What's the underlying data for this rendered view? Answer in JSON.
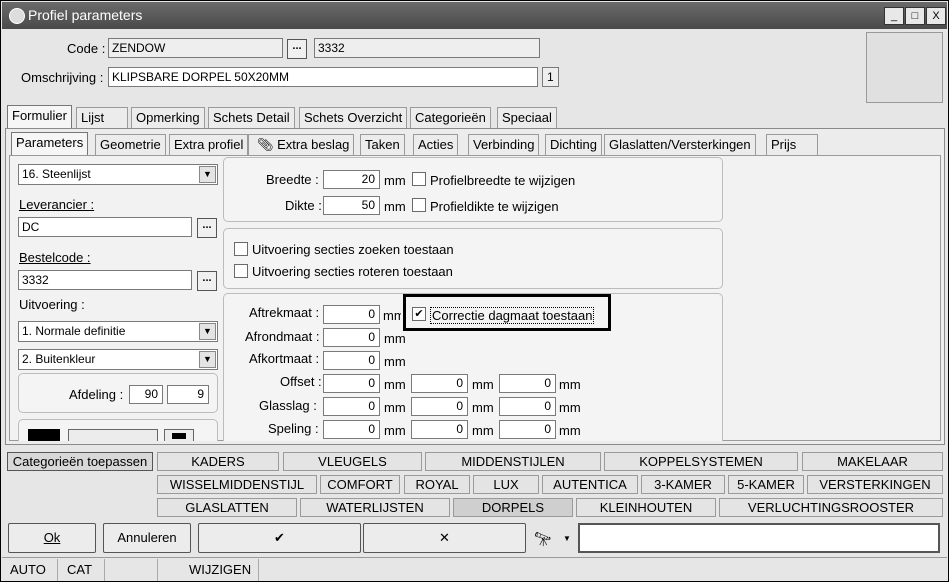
{
  "window": {
    "title": "Profiel parameters",
    "min": "_",
    "max": "□",
    "close": "X"
  },
  "header": {
    "code_label": "Code :",
    "code_value": "ZENDOW",
    "code_number": "3332",
    "desc_label": "Omschrijving :",
    "desc_value": "KLIPSBARE DORPEL 50X20MM",
    "desc_count": "1",
    "dots": "..."
  },
  "main_tabs": [
    "Formulier",
    "Lijst",
    "Opmerking",
    "Schets Detail",
    "Schets Overzicht",
    "Categorieën",
    "Speciaal"
  ],
  "sub_tabs": [
    "Parameters",
    "Geometrie",
    "Extra profiel",
    "Extra beslag",
    "Taken",
    "Acties",
    "Verbinding",
    "Dichting",
    "Glaslatten/Versterkingen",
    "Prijs"
  ],
  "left": {
    "list_select": "16. Steenlijst",
    "leverancier_label": "Leverancier :",
    "leverancier_value": "DC",
    "bestelcode_label": "Bestelcode :",
    "bestelcode_value": "3332",
    "uitvoering_label": "Uitvoering :",
    "uitvoering1": "1.  Normale definitie",
    "uitvoering2": "2.  Buitenkleur",
    "afdeling_label": "Afdeling :",
    "afdeling1": "90",
    "afdeling2": "9"
  },
  "dims": {
    "breedte_label": "Breedte :",
    "breedte": "20",
    "dikte_label": "Dikte :",
    "dikte": "50",
    "unit": "mm",
    "chk_breedte": "Profielbreedte te wijzigen",
    "chk_dikte": "Profieldikte te wijzigen"
  },
  "secties": {
    "zoeken": "Uitvoering secties zoeken toestaan",
    "roteren": "Uitvoering secties roteren toestaan"
  },
  "maten": {
    "aftrek": "Aftrekmaat :",
    "afrond": "Afrondmaat :",
    "afkort": "Afkortmaat :",
    "offset": "Offset :",
    "glasslag": "Glasslag :",
    "speling": "Speling :",
    "zero": "0",
    "correctie": "Correctie dagmaat toestaan"
  },
  "categories": {
    "apply": "Categorieën toepassen",
    "row1": [
      "KADERS",
      "VLEUGELS",
      "MIDDENSTIJLEN",
      "KOPPELSYSTEMEN",
      "MAKELAAR"
    ],
    "row2": [
      "WISSELMIDDENSTIJL",
      "COMFORT",
      "ROYAL",
      "LUX",
      "AUTENTICA",
      "3-KAMER",
      "5-KAMER",
      "VERSTERKINGEN"
    ],
    "row3": [
      "GLASLATTEN",
      "WATERLIJSTEN",
      "DORPELS",
      "KLEINHOUTEN",
      "VERLUCHTINGSROOSTER"
    ]
  },
  "buttons": {
    "ok": "Ok",
    "cancel": "Annuleren",
    "check": "✔",
    "cross": "✕"
  },
  "status": [
    "AUTO",
    "CAT",
    "",
    "WIJZIGEN"
  ]
}
